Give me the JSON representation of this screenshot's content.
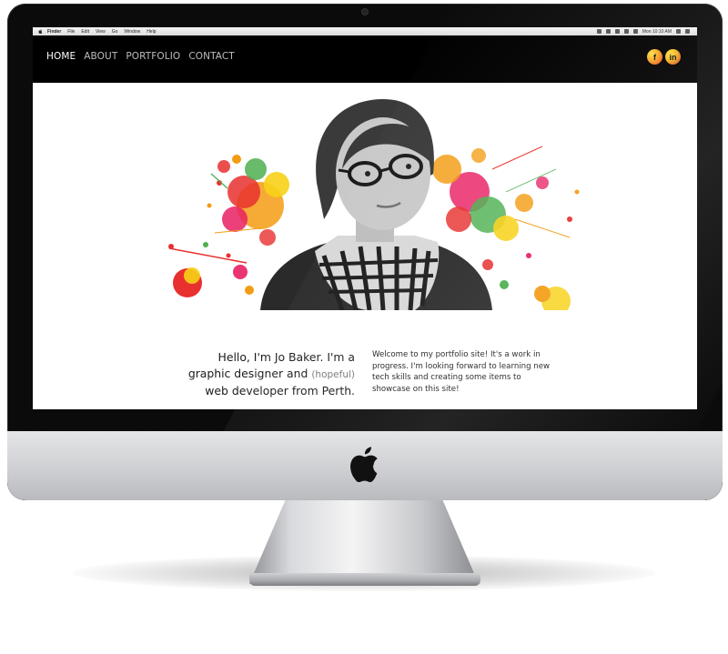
{
  "menubar": {
    "items": [
      "Finder",
      "File",
      "Edit",
      "View",
      "Go",
      "Window",
      "Help"
    ],
    "clock": "Mon 10:10 AM"
  },
  "nav": {
    "links": [
      "HOME",
      "ABOUT",
      "PORTFOLIO",
      "CONTACT"
    ],
    "active": "HOME"
  },
  "social": {
    "facebook_label": "f",
    "linkedin_label": "in"
  },
  "intro": {
    "line1": "Hello, I'm Jo Baker. I'm a",
    "line2_start": "graphic designer and",
    "line2_hopeful": "(hopeful)",
    "line3": "web developer from Perth."
  },
  "welcome": {
    "text": "Welcome to my portfolio site! It's a work in progress. I'm looking forward to learning new tech skills and creating some items to showcase on this site!"
  },
  "colors": {
    "nav_bg": "#000000",
    "nav_active": "#ffffff",
    "nav_inactive": "#bdbdbd",
    "body_text": "#1a1a1a",
    "muted_text": "#777777",
    "splash_red": "#e8302e",
    "splash_orange": "#f39c12",
    "splash_yellow": "#f7d117",
    "splash_green": "#4caf50",
    "splash_pink": "#e91e63"
  },
  "icons": {
    "apple_logo": "apple-logo-icon",
    "facebook": "facebook-icon",
    "linkedin": "linkedin-icon"
  }
}
